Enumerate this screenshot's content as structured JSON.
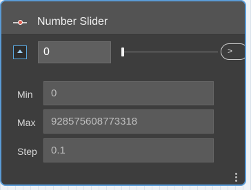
{
  "node": {
    "title": "Number Slider",
    "icon": "number-slider-icon",
    "value": "0",
    "output_port_glyph": ">",
    "slider_position": 0.0
  },
  "settings": {
    "min_label": "Min",
    "min_value": "0",
    "max_label": "Max",
    "max_value": "928575608773318",
    "step_label": "Step",
    "step_value": "0.1"
  },
  "colors": {
    "node_body": "#3d3d3d",
    "node_header": "#535353",
    "selection_border": "#5a9bd6",
    "icon_knob": "#e05a4c"
  }
}
